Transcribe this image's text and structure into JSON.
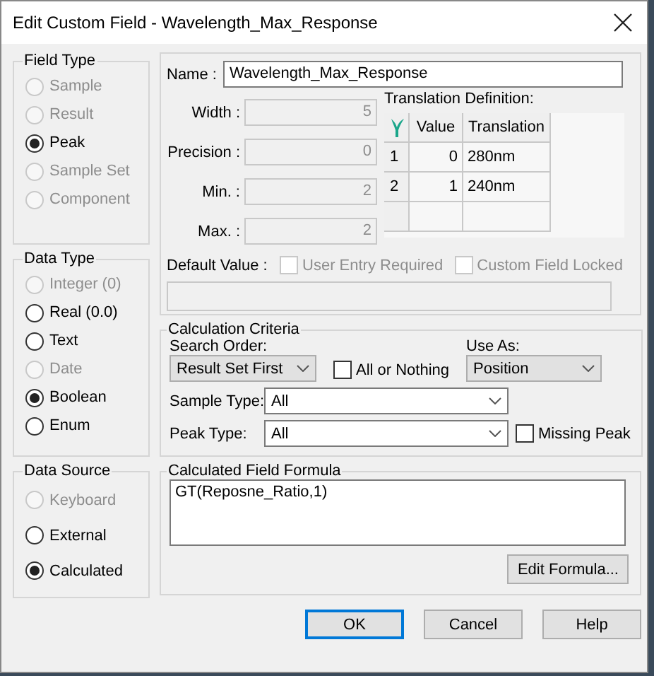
{
  "window": {
    "title": "Edit Custom Field - Wavelength_Max_Response"
  },
  "field_type": {
    "label": "Field Type",
    "options": [
      {
        "label": "Sample",
        "selected": false,
        "disabled": true
      },
      {
        "label": "Result",
        "selected": false,
        "disabled": true
      },
      {
        "label": "Peak",
        "selected": true,
        "disabled": false
      },
      {
        "label": "Sample Set",
        "selected": false,
        "disabled": true
      },
      {
        "label": "Component",
        "selected": false,
        "disabled": true
      }
    ]
  },
  "data_type": {
    "label": "Data Type",
    "options": [
      {
        "label": "Integer (0)",
        "selected": false,
        "disabled": true
      },
      {
        "label": "Real (0.0)",
        "selected": false,
        "disabled": false
      },
      {
        "label": "Text",
        "selected": false,
        "disabled": false
      },
      {
        "label": "Date",
        "selected": false,
        "disabled": true
      },
      {
        "label": "Boolean",
        "selected": true,
        "disabled": false
      },
      {
        "label": "Enum",
        "selected": false,
        "disabled": false
      }
    ]
  },
  "data_source": {
    "label": "Data Source",
    "options": [
      {
        "label": "Keyboard",
        "selected": false,
        "disabled": true
      },
      {
        "label": "External",
        "selected": false,
        "disabled": false
      },
      {
        "label": "Calculated",
        "selected": true,
        "disabled": false
      }
    ]
  },
  "name": {
    "label": "Name :",
    "value": "Wavelength_Max_Response"
  },
  "numeric_fields": [
    {
      "label": "Width :",
      "value": "5",
      "disabled": true
    },
    {
      "label": "Precision :",
      "value": "0",
      "disabled": true
    },
    {
      "label": "Min. :",
      "value": "2",
      "disabled": true
    },
    {
      "label": "Max. :",
      "value": "2",
      "disabled": true
    }
  ],
  "translation": {
    "label": "Translation Definition:",
    "columns": [
      "Value",
      "Translation"
    ],
    "rows": [
      {
        "header": "1",
        "value": "0",
        "translation": "280nm"
      },
      {
        "header": "2",
        "value": "1",
        "translation": "240nm"
      }
    ]
  },
  "default_value": {
    "label": "Default Value :",
    "disabled": true
  },
  "checkboxes": [
    {
      "label": "User Entry Required",
      "checked": false,
      "disabled": true
    },
    {
      "label": "Custom Field Locked",
      "checked": false,
      "disabled": true
    }
  ],
  "calculation_criteria": {
    "label": "Calculation Criteria",
    "search_order": {
      "label": "Search Order:",
      "value": "Result Set First"
    },
    "all_or_nothing": {
      "label": "All or Nothing",
      "checked": false
    },
    "use_as": {
      "label": "Use As:",
      "value": "Position"
    },
    "sample_type": {
      "label": "Sample Type:",
      "value": "All"
    },
    "peak_type": {
      "label": "Peak Type:",
      "value": "All"
    },
    "missing_peak": {
      "label": "Missing Peak",
      "checked": false
    }
  },
  "formula": {
    "label": "Calculated Field Formula",
    "value": "GT(Reposne_Ratio,1)",
    "button": "Edit Formula..."
  },
  "buttons": [
    {
      "label": "OK",
      "default": true
    },
    {
      "label": "Cancel",
      "default": false
    },
    {
      "label": "Help",
      "default": false
    }
  ]
}
